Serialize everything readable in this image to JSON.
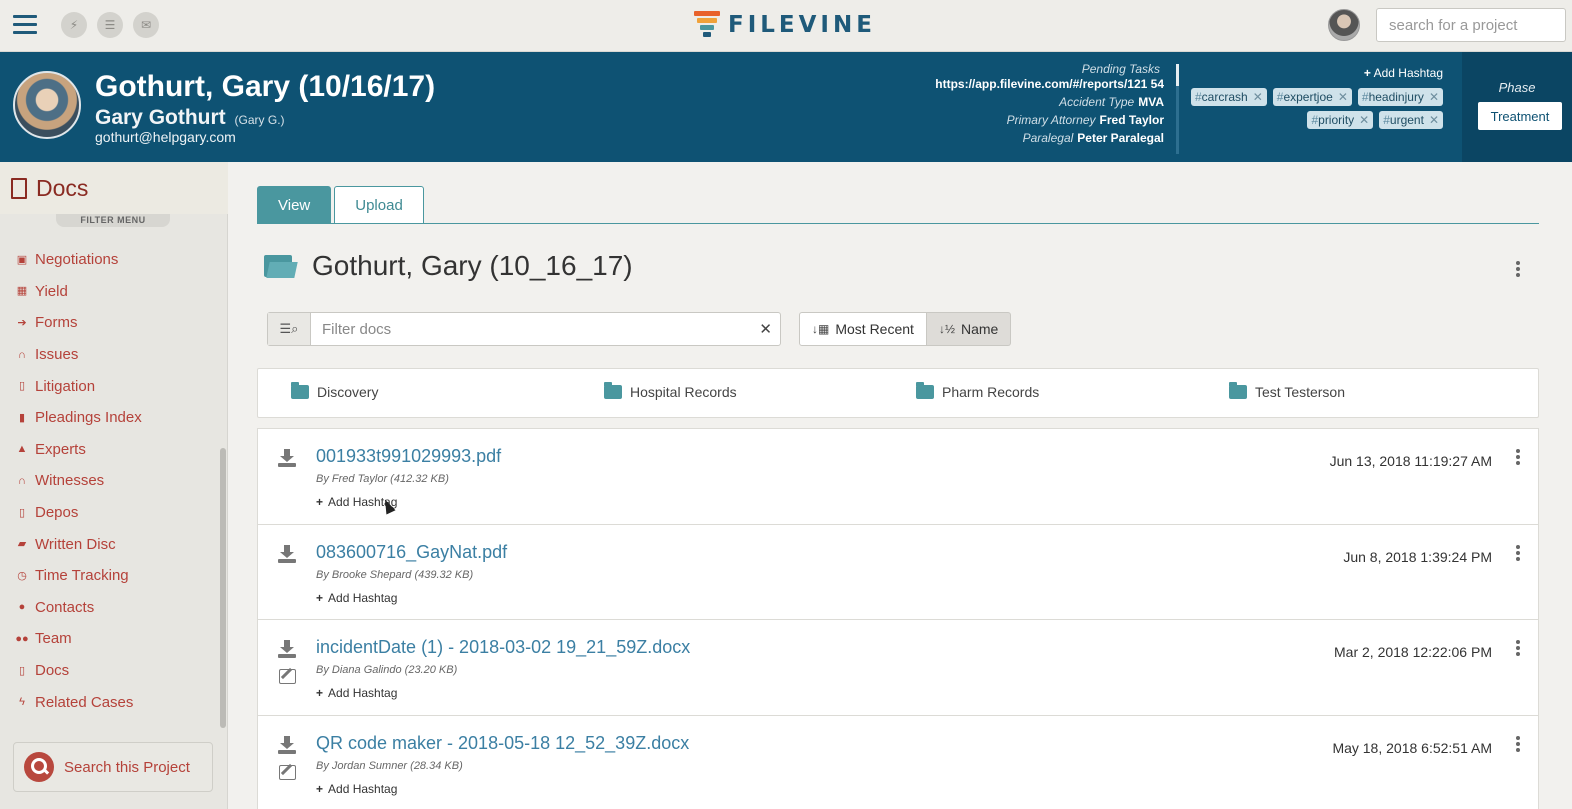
{
  "topbar": {
    "logo_text": "FILEVINE",
    "search_placeholder": "search for a project",
    "quick_buttons": [
      "bolt-icon",
      "list-icon",
      "mail-icon"
    ],
    "logo_colors": [
      "#e8622b",
      "#f0a23a",
      "#4a979f",
      "#1f5a7a"
    ]
  },
  "header": {
    "title": "Gothurt, Gary (10/16/17)",
    "name": "Gary Gothurt",
    "nickname": "(Gary G.)",
    "email": "gothurt@helpgary.com",
    "fields": [
      {
        "label": "Pending Tasks",
        "value": ""
      },
      {
        "label": "",
        "value": "https://app.filevine.com/#/reports/121 54"
      },
      {
        "label": "Accident Type",
        "value": "MVA"
      },
      {
        "label": "Primary Attorney",
        "value": "Fred Taylor"
      },
      {
        "label": "Paralegal",
        "value": "Peter Paralegal"
      }
    ],
    "add_hashtag": "Add Hashtag",
    "tags": [
      "carcrash",
      "expertjoe",
      "headinjury",
      "priority",
      "urgent"
    ],
    "phase_label": "Phase",
    "phase_value": "Treatment"
  },
  "sidebar": {
    "title": "Docs",
    "filter_menu": "FILTER MENU",
    "items": [
      {
        "label": "Negotiations",
        "icon": "money-icon"
      },
      {
        "label": "Yield",
        "icon": "calculator-icon"
      },
      {
        "label": "Forms",
        "icon": "sign-in-icon"
      },
      {
        "label": "Issues",
        "icon": "binoculars-icon"
      },
      {
        "label": "Litigation",
        "icon": "document-icon"
      },
      {
        "label": "Pleadings Index",
        "icon": "file-icon"
      },
      {
        "label": "Experts",
        "icon": "graduation-cap-icon"
      },
      {
        "label": "Witnesses",
        "icon": "binoculars-icon"
      },
      {
        "label": "Depos",
        "icon": "document-icon"
      },
      {
        "label": "Written Disc",
        "icon": "book-icon"
      },
      {
        "label": "Time Tracking",
        "icon": "clock-icon"
      },
      {
        "label": "Contacts",
        "icon": "user-icon"
      },
      {
        "label": "Team",
        "icon": "users-icon"
      },
      {
        "label": "Docs",
        "icon": "document-icon"
      },
      {
        "label": "Related Cases",
        "icon": "bolt-icon"
      }
    ],
    "search_project": "Search this Project"
  },
  "main": {
    "tabs": [
      {
        "label": "View",
        "active": true
      },
      {
        "label": "Upload",
        "active": false
      }
    ],
    "folder_title": "Gothurt, Gary (10_16_17)",
    "filter_placeholder": "Filter docs",
    "sort": {
      "most_recent": "Most Recent",
      "name": "Name"
    },
    "folders": [
      "Discovery",
      "Hospital Records",
      "Pharm Records",
      "Test Testerson"
    ],
    "docs": [
      {
        "name": "001933t991029993.pdf",
        "by": "By Fred Taylor (412.32 KB)",
        "add_hashtag": "Add Hashtag",
        "date": "Jun 13, 2018 11:19:27 AM",
        "editable": false
      },
      {
        "name": "083600716_GayNat.pdf",
        "by": "By Brooke Shepard (439.32 KB)",
        "add_hashtag": "Add Hashtag",
        "date": "Jun 8, 2018 1:39:24 PM",
        "editable": false
      },
      {
        "name": "incidentDate (1) - 2018-03-02 19_21_59Z.docx",
        "by": "By Diana Galindo (23.20 KB)",
        "add_hashtag": "Add Hashtag",
        "date": "Mar 2, 2018 12:22:06 PM",
        "editable": true
      },
      {
        "name": "QR code maker - 2018-05-18 12_52_39Z.docx",
        "by": "By Jordan Sumner (28.34 KB)",
        "add_hashtag": "Add Hashtag",
        "date": "May 18, 2018 6:52:51 AM",
        "editable": true
      }
    ]
  }
}
